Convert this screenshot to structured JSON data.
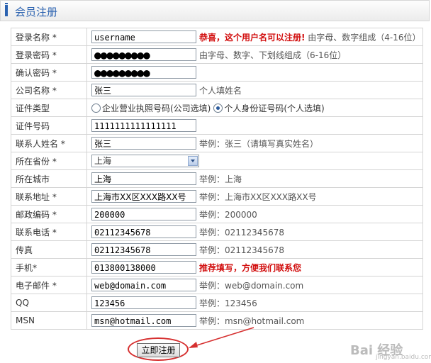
{
  "header": {
    "title": "会员注册"
  },
  "rows": [
    {
      "label": "登录名称 *",
      "value": "username",
      "hint_red": "恭喜，这个用户名可以注册!",
      "hint": " 由字母、数字组成（4-16位）"
    },
    {
      "label": "登录密码 *",
      "value": "●●●●●●●●●",
      "hint": "由字母、数字、下划线组成（6-16位）"
    },
    {
      "label": "确认密码 *",
      "value": "●●●●●●●●●"
    },
    {
      "label": "公司名称 *",
      "value": "张三",
      "hint": "个人填姓名"
    },
    {
      "label": "证件类型",
      "option1": "企业营业执照号码(公司选填)",
      "option2": "个人身份证号码(个人选填)"
    },
    {
      "label": "证件号码",
      "value": "1111111111111111"
    },
    {
      "label": "联系人姓名 *",
      "value": "张三",
      "hint": "举例：张三（请填写真实姓名）"
    },
    {
      "label": "所在省份 *",
      "value": "上海"
    },
    {
      "label": "所在城市",
      "value": "上海",
      "hint": "举例：上海"
    },
    {
      "label": "联系地址 *",
      "value": "上海市XX区XXX路XX号",
      "hint": "举例：上海市XX区XXX路XX号"
    },
    {
      "label": "邮政编码 *",
      "value": "200000",
      "hint": "举例：200000"
    },
    {
      "label": "联系电话 *",
      "value": "02112345678",
      "hint": "举例：02112345678"
    },
    {
      "label": "传真",
      "value": "02112345678",
      "hint": "举例：02112345678"
    },
    {
      "label": "手机*",
      "value": "013800138000",
      "hint_red": "推荐填写，方便我们联系您"
    },
    {
      "label": "电子邮件 *",
      "value": "web@domain.com",
      "hint": "举例：web@domain.com"
    },
    {
      "label": "QQ",
      "value": "123456",
      "hint": "举例：123456"
    },
    {
      "label": "MSN",
      "value": "msn@hotmail.com",
      "hint": "举例：msn@hotmail.com"
    }
  ],
  "submit_label": "立即注册",
  "watermark": "Bai 经验",
  "watermark_sub": "jingyan.baidu.com",
  "colors": {
    "accent": "#2b62b0",
    "alert_red": "#d21010",
    "annotation_red": "#d63030"
  }
}
